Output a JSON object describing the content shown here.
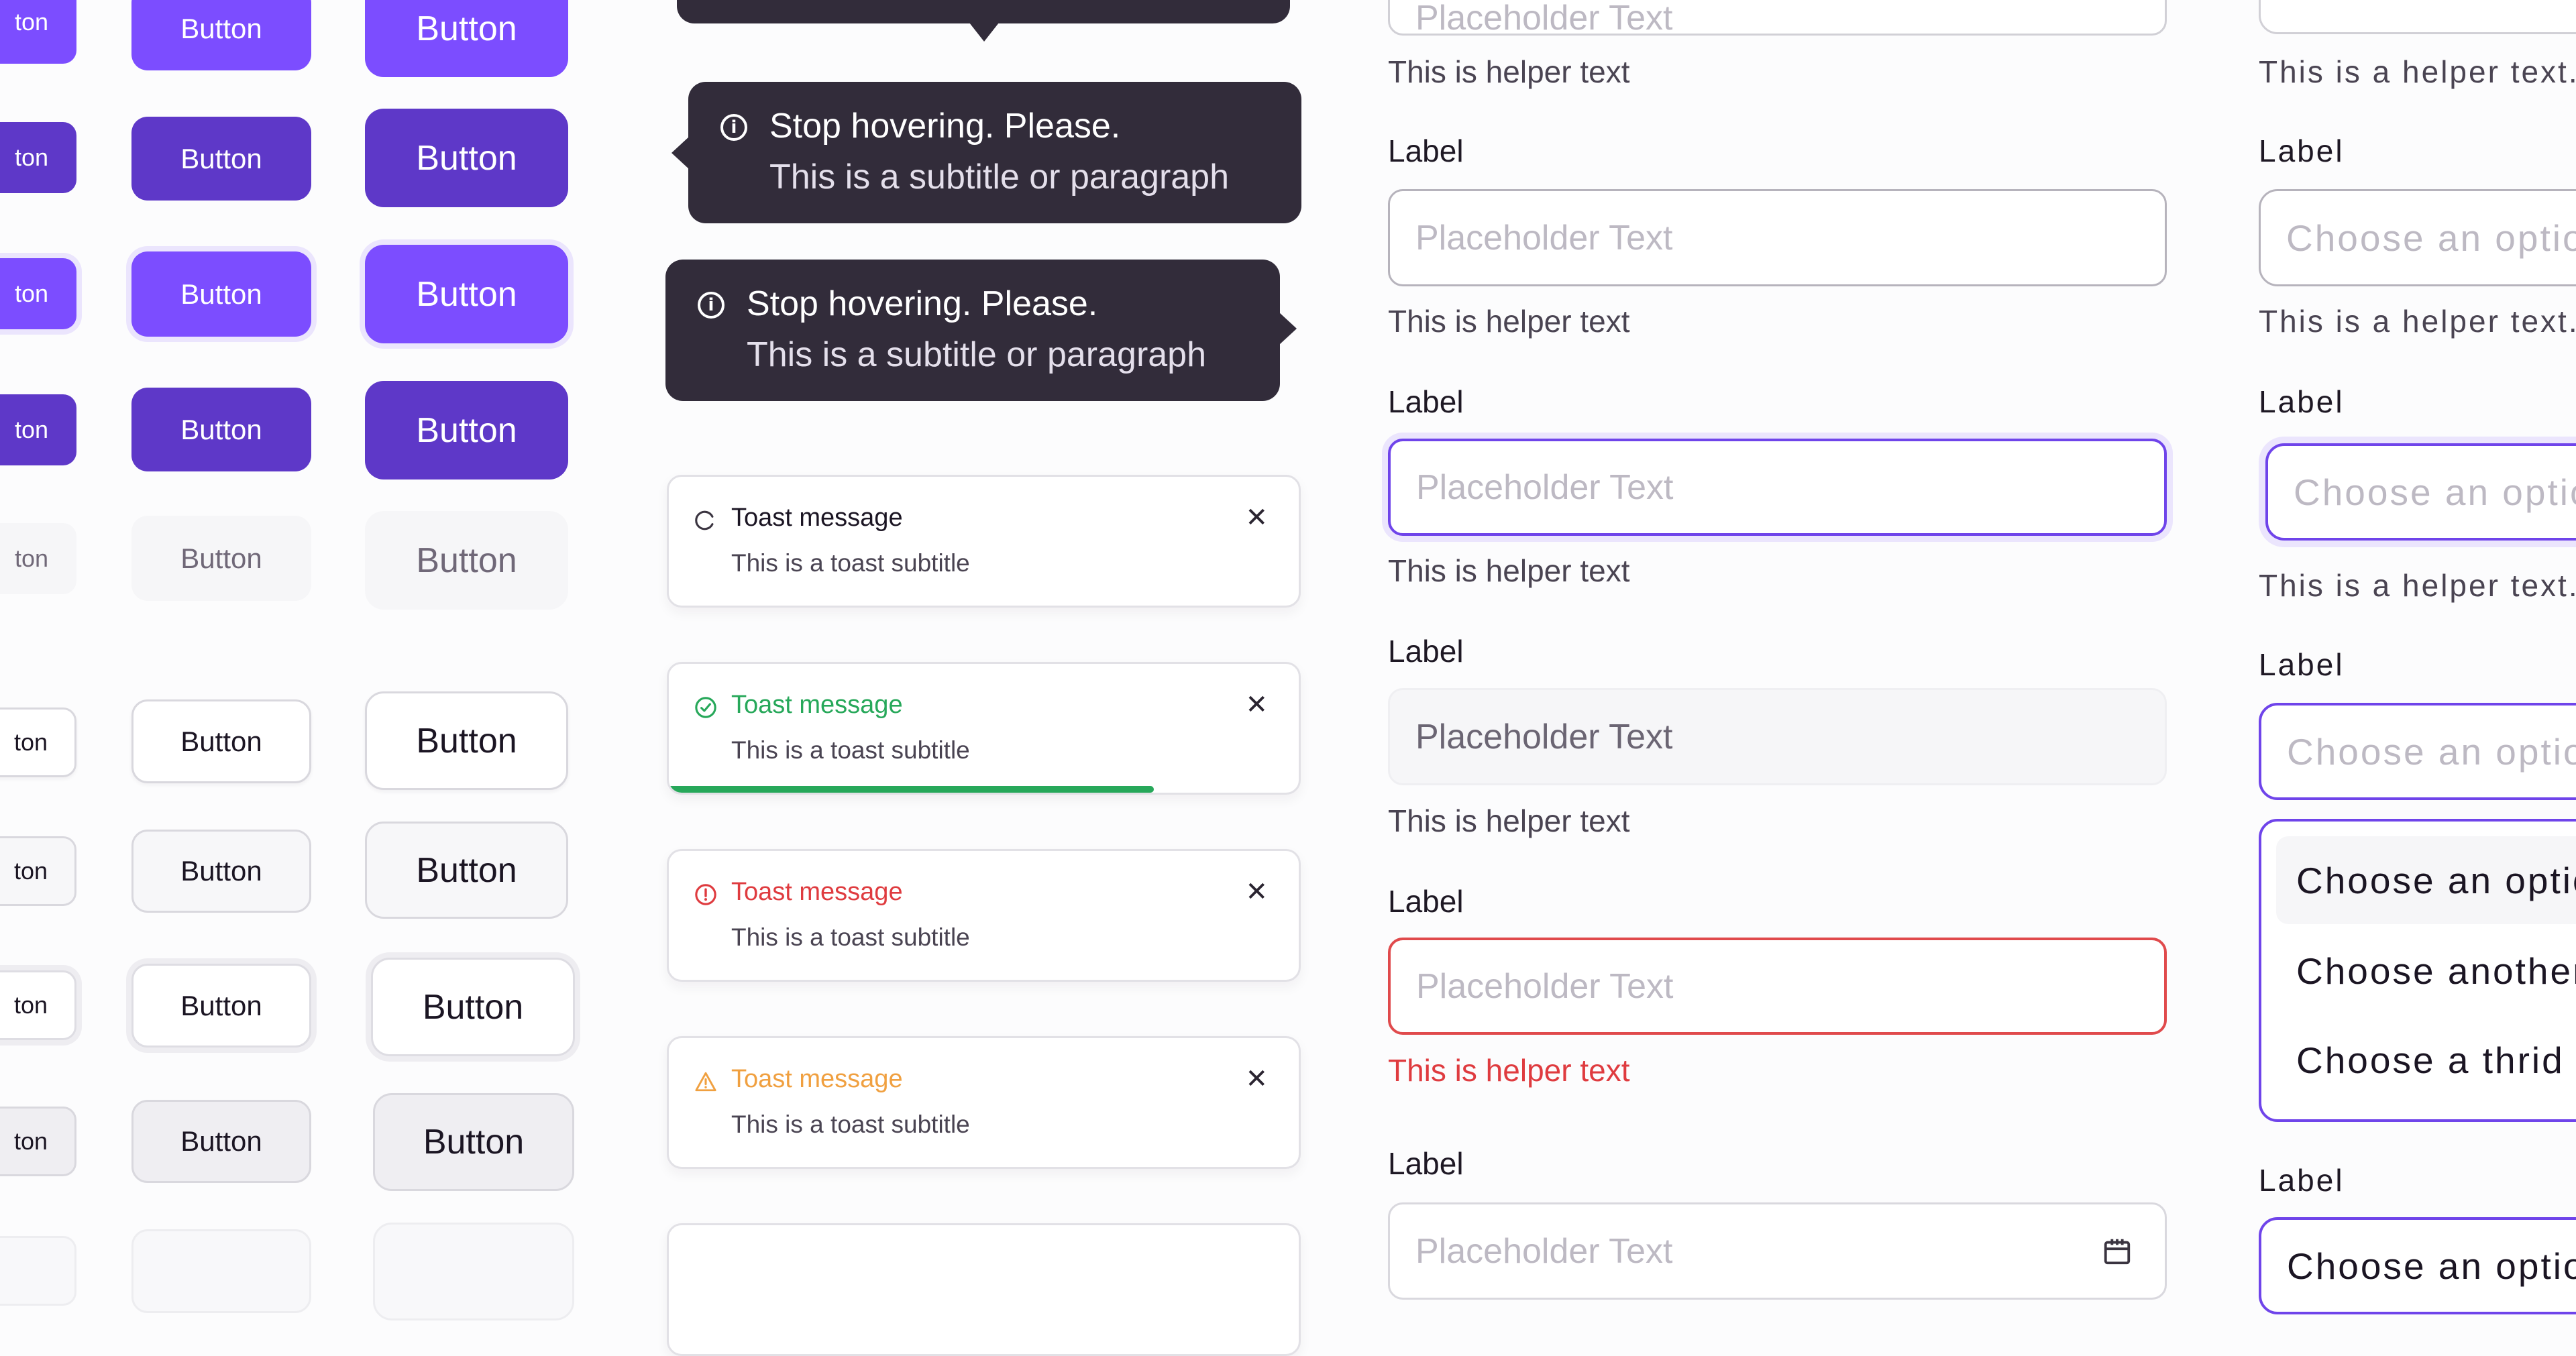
{
  "colors": {
    "primary": "#7c4dff",
    "primary_pressed": "#5e38c8",
    "focus_ring": "#ebe5fd",
    "tooltip_bg": "#322c3a",
    "success": "#27a85a",
    "error": "#df3b3f",
    "warning": "#f0a040"
  },
  "buttons": {
    "primary_rows": [
      {
        "state": "default",
        "label": "Button"
      },
      {
        "state": "pressed",
        "label": "Button"
      },
      {
        "state": "focused",
        "label": "Button"
      },
      {
        "state": "pressed",
        "label": "Button"
      },
      {
        "state": "disabled",
        "label": "Button"
      }
    ],
    "secondary_rows": [
      {
        "state": "default",
        "label": "Button"
      },
      {
        "state": "hover",
        "label": "Button"
      },
      {
        "state": "focused",
        "label": "Button"
      },
      {
        "state": "pressed",
        "label": "Button"
      },
      {
        "state": "disabled",
        "label": "Button"
      }
    ],
    "partial_label": "ton"
  },
  "tooltips": [
    {
      "arrow": "bottom",
      "title": "",
      "subtitle": ""
    },
    {
      "arrow": "left",
      "icon": "info-icon",
      "title": "Stop hovering. Please.",
      "subtitle": "This is a subtitle or paragraph"
    },
    {
      "arrow": "right",
      "icon": "info-icon",
      "title": "Stop hovering. Please.",
      "subtitle": "This is a subtitle or paragraph"
    }
  ],
  "toasts": [
    {
      "variant": "loading",
      "icon": "spinner-icon",
      "title": "Toast message",
      "subtitle": "This is a toast subtitle",
      "close": "✕"
    },
    {
      "variant": "success",
      "icon": "check-circle-icon",
      "title": "Toast message",
      "subtitle": "This is a toast subtitle",
      "close": "✕",
      "progress": 0.77
    },
    {
      "variant": "error",
      "icon": "alert-circle-icon",
      "title": "Toast message",
      "subtitle": "This is a toast subtitle",
      "close": "✕"
    },
    {
      "variant": "warning",
      "icon": "warning-triangle-icon",
      "title": "Toast message",
      "subtitle": "This is a toast subtitle",
      "close": "✕"
    }
  ],
  "inputs": {
    "top_helper": "This is helper text",
    "fields": [
      {
        "state": "default",
        "label": "Label",
        "placeholder": "Placeholder Text",
        "helper": "This is helper text"
      },
      {
        "state": "focused",
        "label": "Label",
        "placeholder": "Placeholder Text",
        "helper": "This is helper text"
      },
      {
        "state": "disabled",
        "label": "Label",
        "placeholder": "Placeholder Text",
        "helper": "This is helper text"
      },
      {
        "state": "error",
        "label": "Label",
        "placeholder": "Placeholder Text",
        "helper": "This is helper text"
      },
      {
        "state": "date",
        "label": "Label",
        "placeholder": "Placeholder Text",
        "icon": "calendar-icon"
      }
    ]
  },
  "selects": {
    "top_helper": "This is a helper text.",
    "fields": [
      {
        "state": "default",
        "label": "Label",
        "placeholder": "Choose an option",
        "helper": "This is a helper text."
      },
      {
        "state": "focused",
        "label": "Label",
        "placeholder": "Choose an option",
        "helper": "This is a helper text."
      },
      {
        "state": "open",
        "label": "Label",
        "placeholder": "Choose an option"
      },
      {
        "state": "filled",
        "label": "Label",
        "value": "Choose an option"
      }
    ],
    "options": [
      "Choose an option",
      "Choose another option",
      "Choose a thrid option"
    ]
  }
}
